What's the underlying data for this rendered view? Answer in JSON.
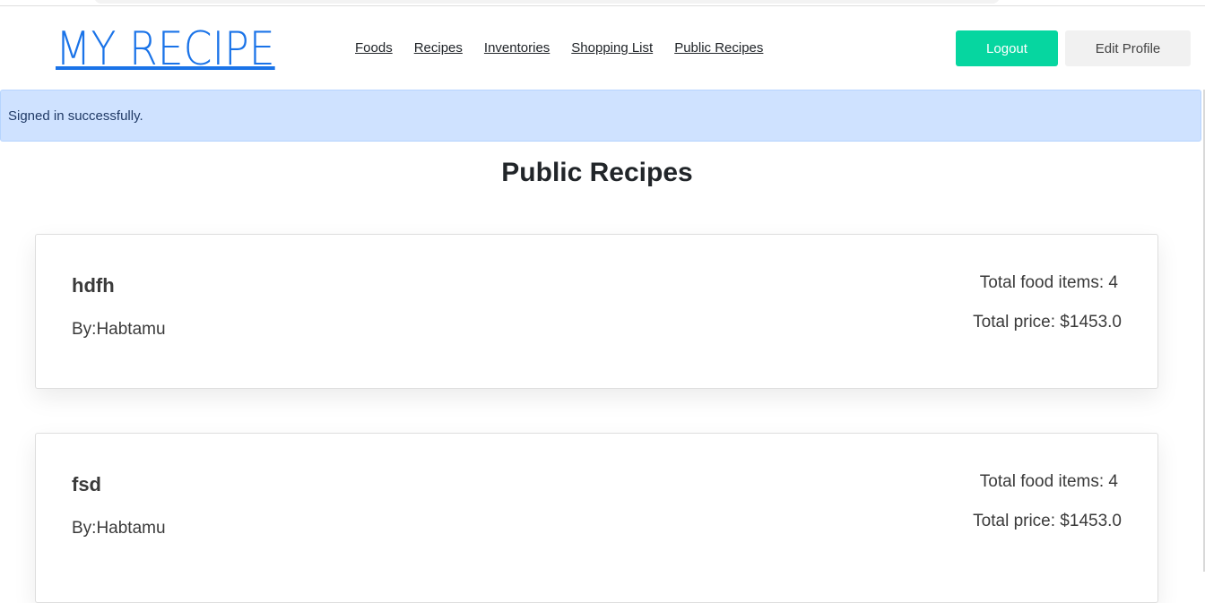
{
  "header": {
    "logo": "MY RECIPE",
    "nav": [
      "Foods",
      "Recipes",
      "Inventories",
      "Shopping List",
      "Public Recipes"
    ],
    "logout_label": "Logout",
    "edit_profile_label": "Edit Profile"
  },
  "alert": {
    "message": "Signed in successfully."
  },
  "main": {
    "title": "Public Recipes",
    "recipes": [
      {
        "name": "hdfh",
        "author": "By:Habtamu",
        "items": "Total food items: 4",
        "price": "Total price: $1453.0"
      },
      {
        "name": "fsd",
        "author": "By:Habtamu",
        "items": "Total food items: 4",
        "price": "Total price: $1453.0"
      }
    ]
  },
  "colors": {
    "logo": "#1a73e8",
    "logout": "#06d6a0",
    "alert_bg": "#cfe2ff"
  }
}
